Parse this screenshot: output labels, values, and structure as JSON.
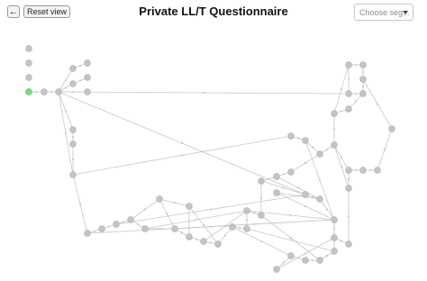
{
  "toolbar": {
    "back_icon": "arrow-left-icon",
    "back_glyph": "←",
    "reset_label": "Reset view"
  },
  "title": "Private LL/T Questionnaire",
  "segment": {
    "placeholder": "Choose seg...",
    "caret_icon": "caret-down-icon"
  },
  "colors": {
    "node": "#c4c4c4",
    "start_node": "#6fe070",
    "edge": "#c7c7c7"
  },
  "graph": {
    "node_count": 59,
    "start_node_index": 3
  }
}
